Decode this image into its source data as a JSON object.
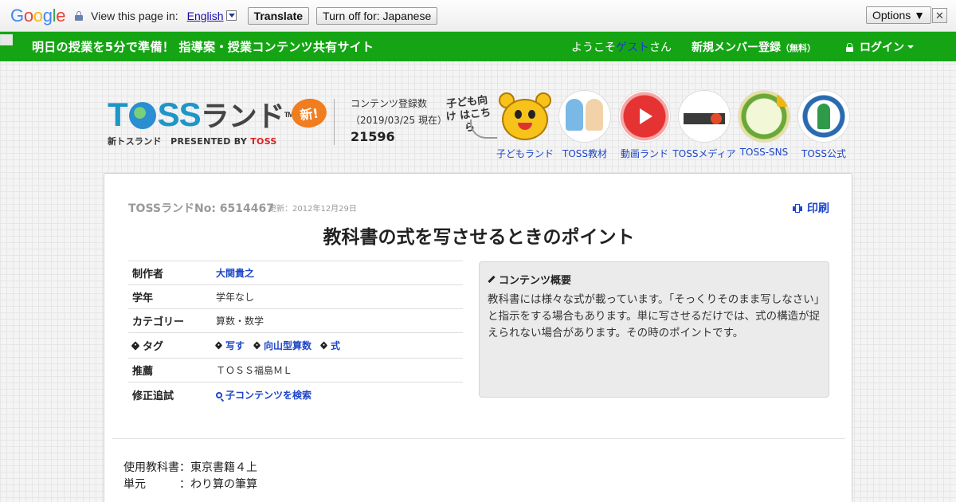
{
  "translate_bar": {
    "logo_letters": [
      {
        "ch": "G",
        "color": "#4285f4"
      },
      {
        "ch": "o",
        "color": "#ea4335"
      },
      {
        "ch": "o",
        "color": "#fbbc05"
      },
      {
        "ch": "g",
        "color": "#4285f4"
      },
      {
        "ch": "l",
        "color": "#34a853"
      },
      {
        "ch": "e",
        "color": "#ea4335"
      }
    ],
    "view_label": "View this page in:",
    "language": "English",
    "translate_button": "Translate",
    "turn_off_button": "Turn off for: Japanese",
    "options_button": "Options ▼",
    "close_glyph": "✕"
  },
  "site_bar": {
    "tagline": "明日の授業を5分で準備！ 指導案・授業コンテンツ共有サイト",
    "welcome_prefix": "ようこそ",
    "welcome_guest": "ゲスト",
    "welcome_suffix": "さん",
    "register": "新規メンバー登録",
    "register_note": "（無料）",
    "login": "ログイン",
    "color": "#15a514"
  },
  "header": {
    "logo_t": "T",
    "logo_ss": "SS",
    "logo_land": "ランド",
    "logo_tm": "TM",
    "logo_new": "新!",
    "logo_sub_left": "新トスランド　PRESENTED BY ",
    "logo_sub_brand": "TOSS",
    "count_label": "コンテンツ登録数",
    "count_date": "（2019/03/25 現在）",
    "count_value": "21596",
    "kids_hint": "子ども向け はこちら"
  },
  "nav": [
    {
      "label": "子どもランド"
    },
    {
      "label": "TOSS教材"
    },
    {
      "label": "動画ランド"
    },
    {
      "label": "TOSSメディア"
    },
    {
      "label": "TOSS-SNS"
    },
    {
      "label": "TOSS公式"
    }
  ],
  "content": {
    "land_no": "TOSSランドNo: 6514467",
    "updated": "更新：2012年12月29日",
    "print": "印刷",
    "title": "教科書の式を写させるときのポイント",
    "info": {
      "author_key": "制作者",
      "author_val": "大関貴之",
      "grade_key": "学年",
      "grade_val": "学年なし",
      "category_key": "カテゴリー",
      "category_val": "算数・数学",
      "tags_key": "タグ",
      "tags": [
        "写す",
        "向山型算数",
        "式"
      ],
      "recommend_key": "推薦",
      "recommend_val": "ＴＯＳＳ福島ＭＬ",
      "revision_key": "修正追試",
      "revision_val": "子コンテンツを検索"
    },
    "summary_heading": "コンテンツ概要",
    "summary_text": "教科書には様々な式が載っています。「そっくりそのまま写しなさい」と指示をする場合もあります。単に写させるだけでは、式の構造が捉えられない場合があります。その時のポイントです。",
    "body_line1": "使用教科書：東京書籍４上",
    "body_line2": "単元　　　：わり算の筆算"
  }
}
